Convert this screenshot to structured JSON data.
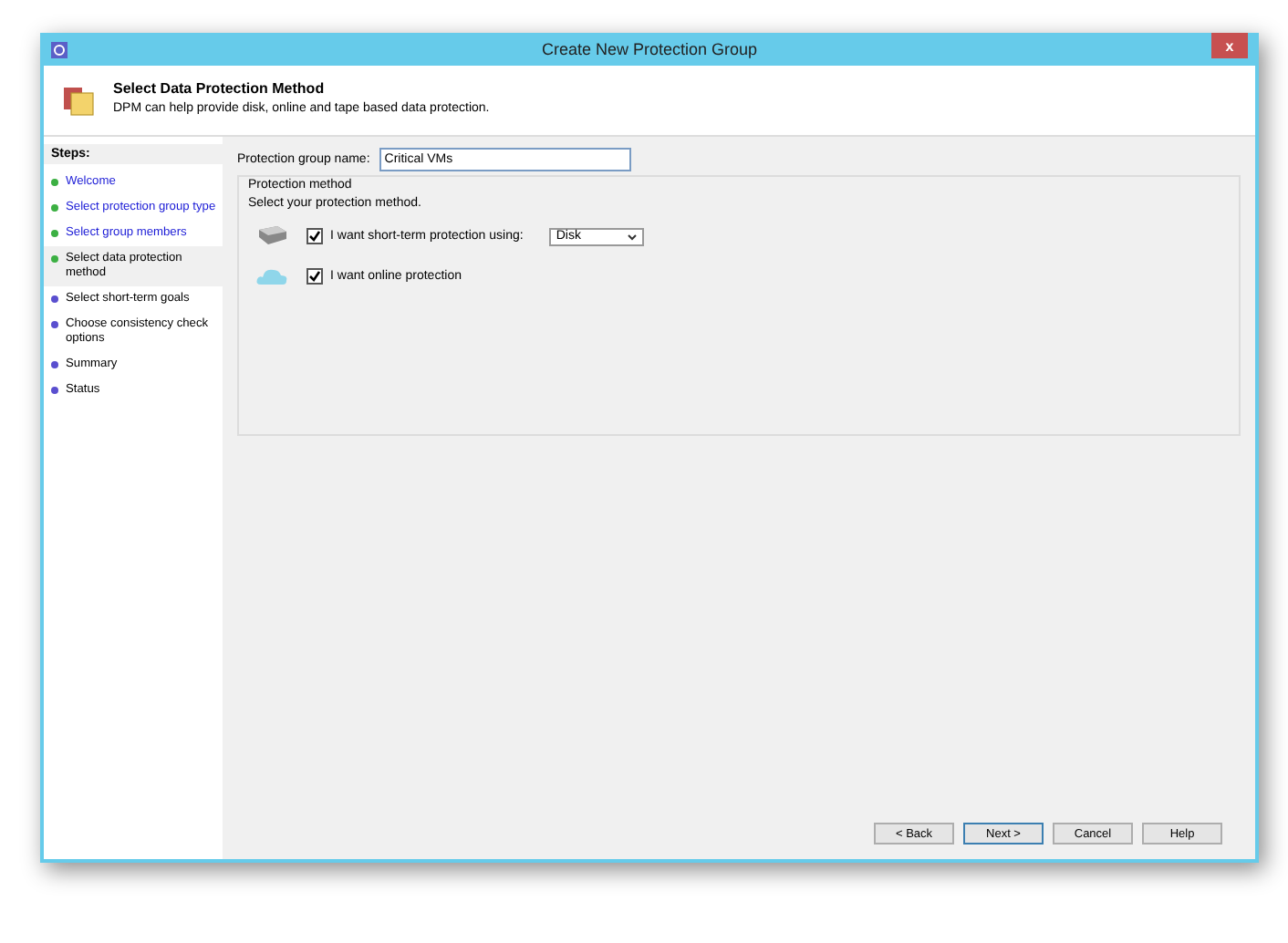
{
  "window": {
    "title": "Create New Protection Group",
    "close": "x"
  },
  "header": {
    "title": "Select Data Protection Method",
    "subtitle": "DPM can help provide disk, online and tape based data protection."
  },
  "steps": {
    "heading": "Steps:",
    "items": [
      {
        "label": "Welcome",
        "completed": true,
        "color": "#3cb043",
        "selected": false
      },
      {
        "label": "Select protection group type",
        "completed": true,
        "color": "#3cb043",
        "selected": false
      },
      {
        "label": "Select group members",
        "completed": true,
        "color": "#3cb043",
        "selected": false
      },
      {
        "label": "Select data protection method",
        "completed": false,
        "color": "#3cb043",
        "selected": true
      },
      {
        "label": "Select short-term goals",
        "completed": false,
        "color": "#5a4fcf",
        "selected": false
      },
      {
        "label": "Choose consistency check options",
        "completed": false,
        "color": "#5a4fcf",
        "selected": false
      },
      {
        "label": "Summary",
        "completed": false,
        "color": "#5a4fcf",
        "selected": false
      },
      {
        "label": "Status",
        "completed": false,
        "color": "#5a4fcf",
        "selected": false
      }
    ]
  },
  "group_name": {
    "label": "Protection group name:",
    "value": "Critical VMs"
  },
  "protection_method": {
    "legend": "Protection method",
    "instruction": "Select your protection method.",
    "options": [
      {
        "kind": "disk",
        "label": "I want short-term protection using:",
        "checked": true,
        "dropdown": "Disk"
      },
      {
        "kind": "cloud",
        "label": "I want online protection",
        "checked": true
      }
    ]
  },
  "buttons": [
    "< Back",
    "Next >",
    "Cancel",
    "Help"
  ]
}
